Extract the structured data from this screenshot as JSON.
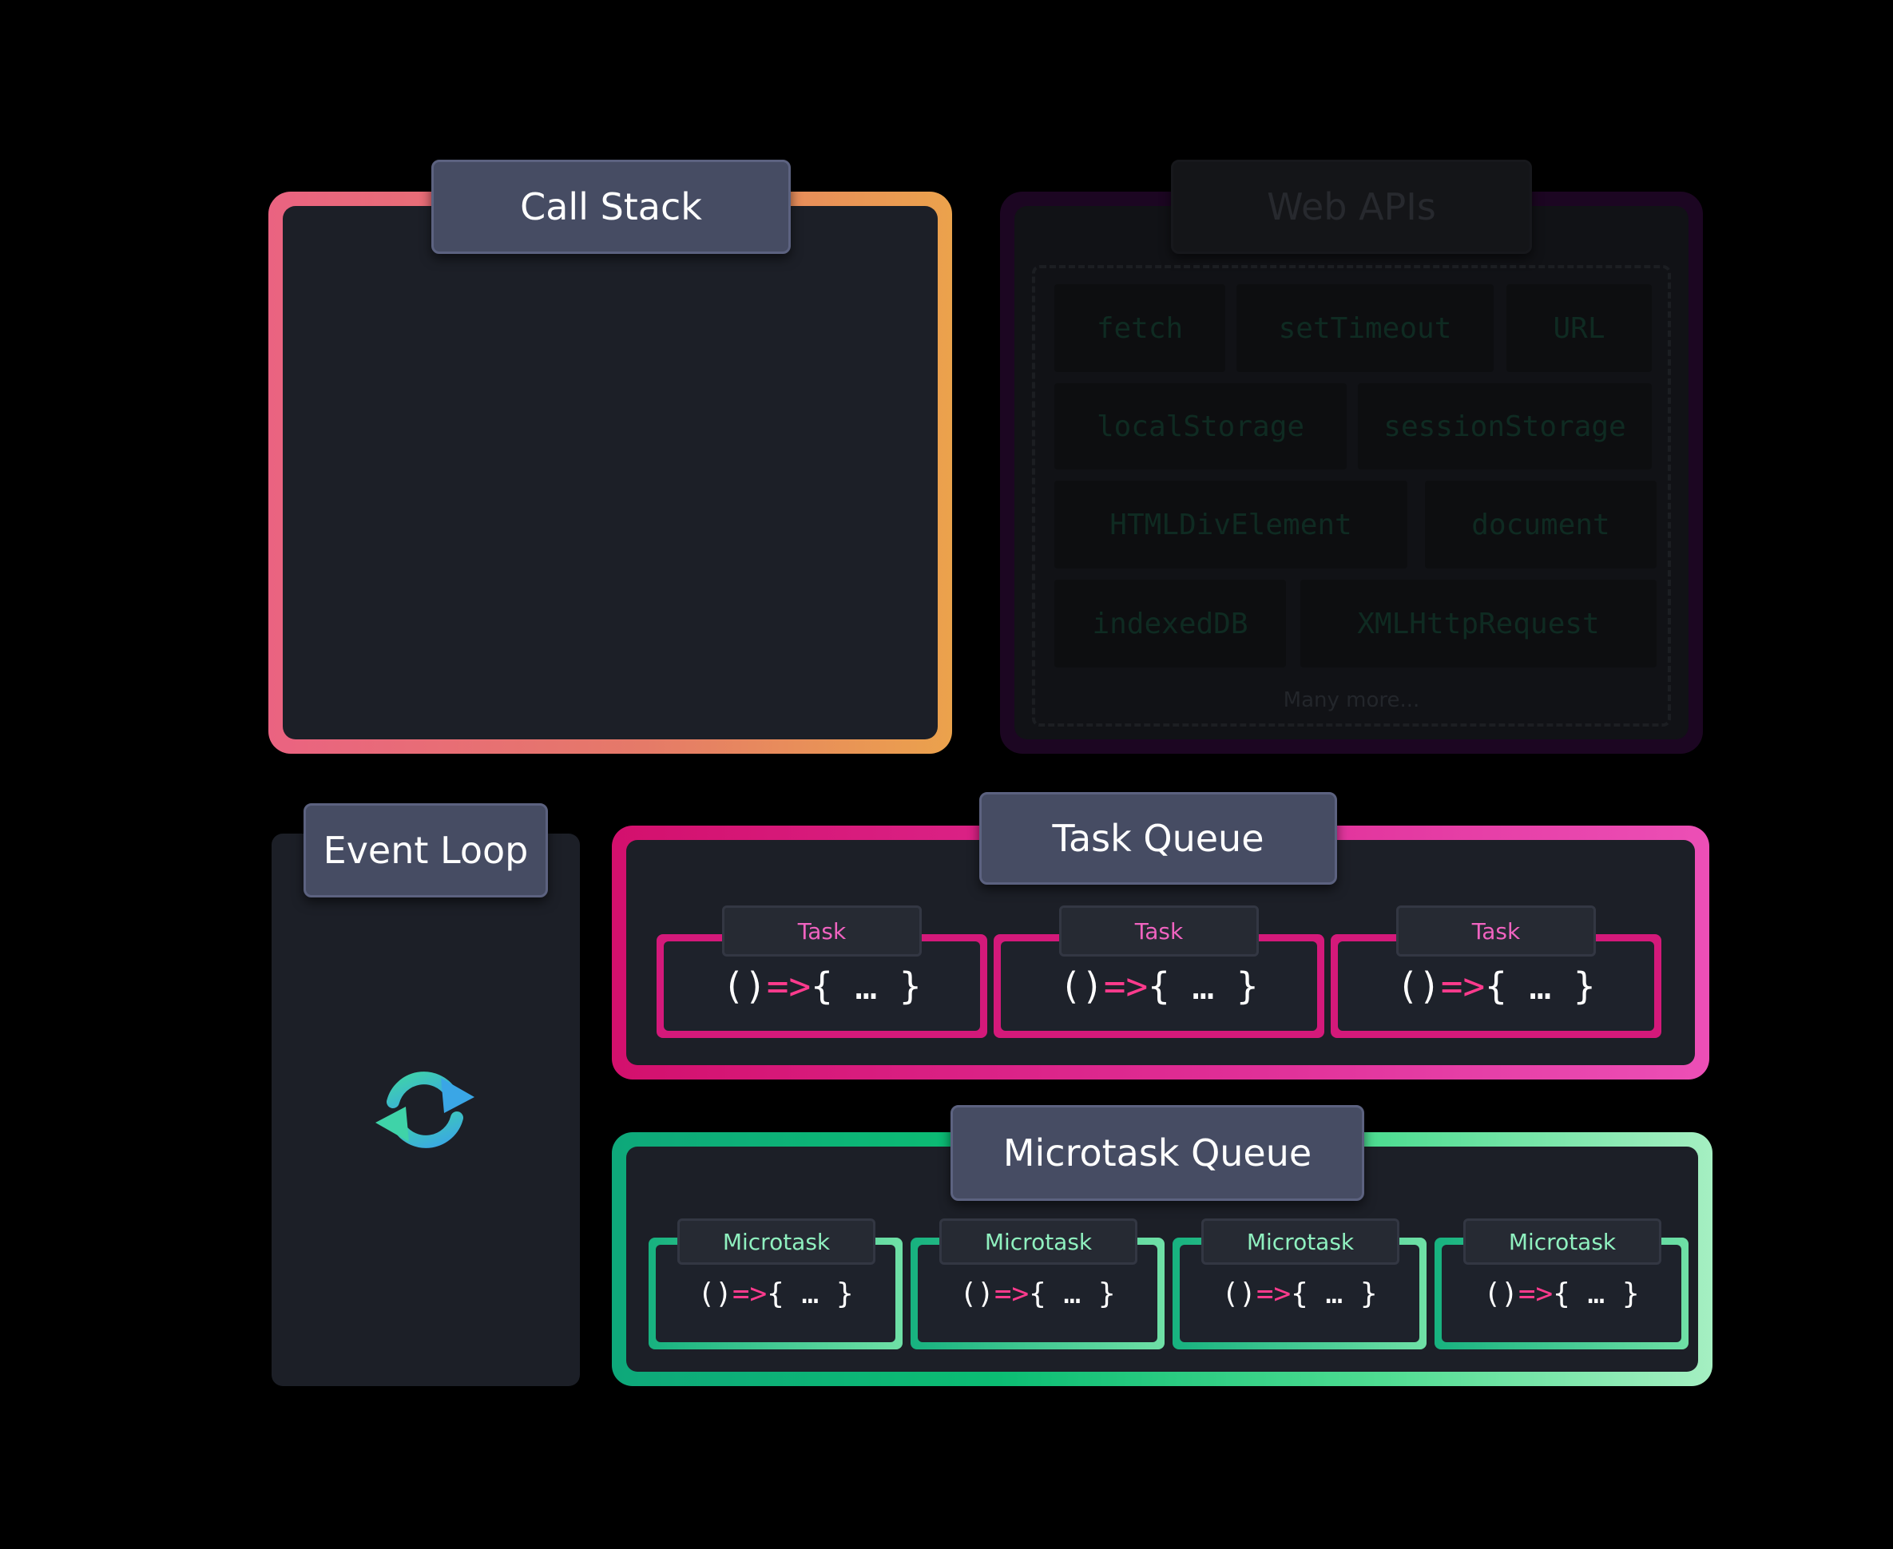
{
  "colors": {
    "background": "#000000",
    "panel": "#1c1f27",
    "label_tab": "#464c63",
    "call_stack_gradient": [
      "#ea6381",
      "#eba24c"
    ],
    "web_apis_border": "#1c0622",
    "task_queue_gradient": [
      "#d3106d",
      "#ec4fb6"
    ],
    "microtask_queue_gradient": [
      "#0ea87a",
      "#a5efc2"
    ],
    "arrow": "#ff3b8d",
    "task_label": "#f063c0",
    "microtask_label": "#8ff0bf"
  },
  "call_stack": {
    "title": "Call Stack"
  },
  "web_apis": {
    "title": "Web APIs",
    "items": [
      "fetch",
      "setTimeout",
      "URL",
      "localStorage",
      "sessionStorage",
      "HTMLDivElement",
      "document",
      "indexedDB",
      "XMLHttpRequest"
    ],
    "more": "Many more..."
  },
  "event_loop": {
    "title": "Event Loop",
    "icon": "refresh-cycle-icon"
  },
  "task_queue": {
    "title": "Task Queue",
    "tasks": [
      {
        "label": "Task",
        "code_open": "()",
        "arrow": "=>",
        "body": "{ … }"
      },
      {
        "label": "Task",
        "code_open": "()",
        "arrow": "=>",
        "body": "{ … }"
      },
      {
        "label": "Task",
        "code_open": "()",
        "arrow": "=>",
        "body": "{ … }"
      }
    ]
  },
  "microtask_queue": {
    "title": "Microtask Queue",
    "microtasks": [
      {
        "label": "Microtask",
        "code_open": "()",
        "arrow": "=>",
        "body": "{ … }"
      },
      {
        "label": "Microtask",
        "code_open": "()",
        "arrow": "=>",
        "body": "{ … }"
      },
      {
        "label": "Microtask",
        "code_open": "()",
        "arrow": "=>",
        "body": "{ … }"
      },
      {
        "label": "Microtask",
        "code_open": "()",
        "arrow": "=>",
        "body": "{ … }"
      }
    ]
  }
}
